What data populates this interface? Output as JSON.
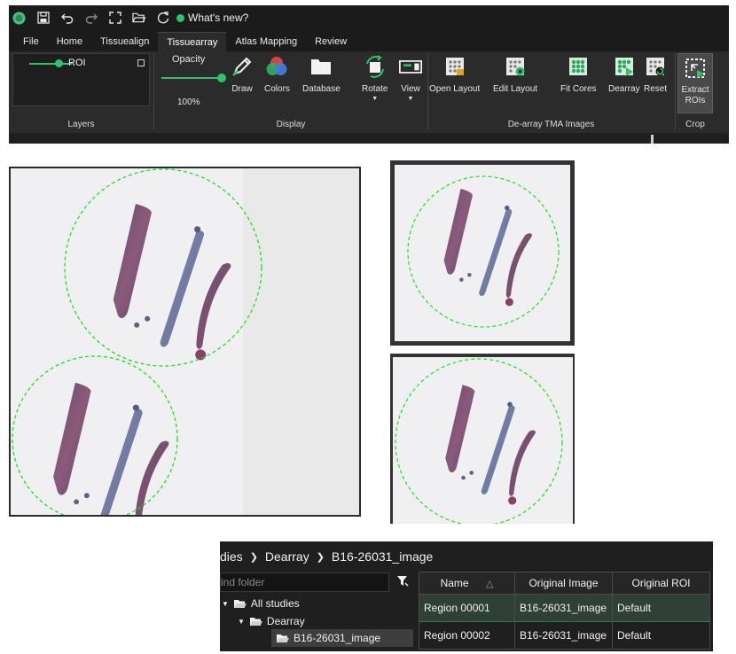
{
  "titlebar": {
    "whats_new": "What's new?",
    "icons": [
      "app-logo-icon",
      "save-icon",
      "undo-icon",
      "redo-icon",
      "fullscreen-icon",
      "open-folder-icon",
      "refresh-icon"
    ]
  },
  "menu": {
    "items": [
      {
        "label": "File"
      },
      {
        "label": "Home"
      },
      {
        "label": "Tissuealign"
      },
      {
        "label": "Tissuearray",
        "active": true
      },
      {
        "label": "Atlas Mapping"
      },
      {
        "label": "Review"
      }
    ]
  },
  "ribbon": {
    "layers": {
      "group_label": "Layers",
      "roi_label": "ROI"
    },
    "display": {
      "group_label": "Display",
      "opacity_label": "Opacity",
      "opacity_value": "100%",
      "opacity_level": 1.0,
      "buttons": [
        {
          "label": "Draw",
          "icon": "pencil-icon"
        },
        {
          "label": "Colors",
          "icon": "colors-icon"
        },
        {
          "label": "Database",
          "icon": "folder-icon"
        },
        {
          "label": "Rotate",
          "icon": "rotate-icon"
        },
        {
          "label": "View",
          "icon": "view-icon"
        }
      ]
    },
    "dearray": {
      "group_label": "De-array TMA Images",
      "buttons": [
        {
          "label": "Open Layout",
          "icon": "open-layout-icon"
        },
        {
          "label": "Edit Layout",
          "icon": "edit-layout-icon"
        },
        {
          "label": "Fit Cores",
          "icon": "fit-cores-icon"
        },
        {
          "label": "Dearray",
          "icon": "dearray-icon"
        },
        {
          "label": "Reset",
          "icon": "reset-icon"
        }
      ]
    },
    "crop": {
      "group_label": "Crop",
      "extract_line1": "Extract",
      "extract_line2": "ROIs"
    }
  },
  "colors": {
    "accent_green": "#2fc36b",
    "roi_circle": "#1ee01e",
    "ribbon_bg": "#2b2b2b"
  },
  "browser": {
    "breadcrumb": [
      "dies",
      "Dearray",
      "B16-26031_image"
    ],
    "find_placeholder": "ind folder",
    "tree": [
      {
        "label": "All studies"
      },
      {
        "label": "Dearray"
      },
      {
        "label": "B16-26031_image",
        "selected": true
      }
    ],
    "table": {
      "columns": [
        "Name",
        "Original Image",
        "Original ROI"
      ],
      "rows": [
        {
          "name": "Region 00001",
          "original_image": "B16-26031_image",
          "original_roi": "Default",
          "selected": true
        },
        {
          "name": "Region 00002",
          "original_image": "B16-26031_image",
          "original_roi": "Default"
        }
      ]
    }
  }
}
